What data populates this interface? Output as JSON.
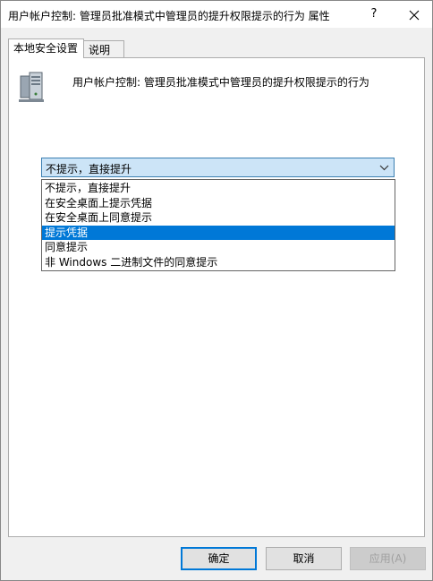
{
  "window": {
    "title": "用户帐户控制: 管理员批准模式中管理员的提升权限提示的行为 属性",
    "help_label": "?",
    "close_label": "✕"
  },
  "tabs": [
    {
      "label": "本地安全设置",
      "active": true
    },
    {
      "label": "说明",
      "active": false
    }
  ],
  "policy": {
    "icon": "server-computer-icon",
    "name": "用户帐户控制: 管理员批准模式中管理员的提升权限提示的行为"
  },
  "select": {
    "value": "不提示，直接提升",
    "icon": "chevron-down-icon",
    "options": [
      "不提示，直接提升",
      "在安全桌面上提示凭据",
      "在安全桌面上同意提示",
      "提示凭据",
      "同意提示",
      "非 Windows 二进制文件的同意提示"
    ],
    "highlighted_index": 3
  },
  "buttons": {
    "ok": "确定",
    "cancel": "取消",
    "apply": "应用(A)"
  },
  "colors": {
    "highlight": "#0078d7",
    "select_bg": "#cce4f7",
    "window_bg": "#f0f0f0"
  }
}
